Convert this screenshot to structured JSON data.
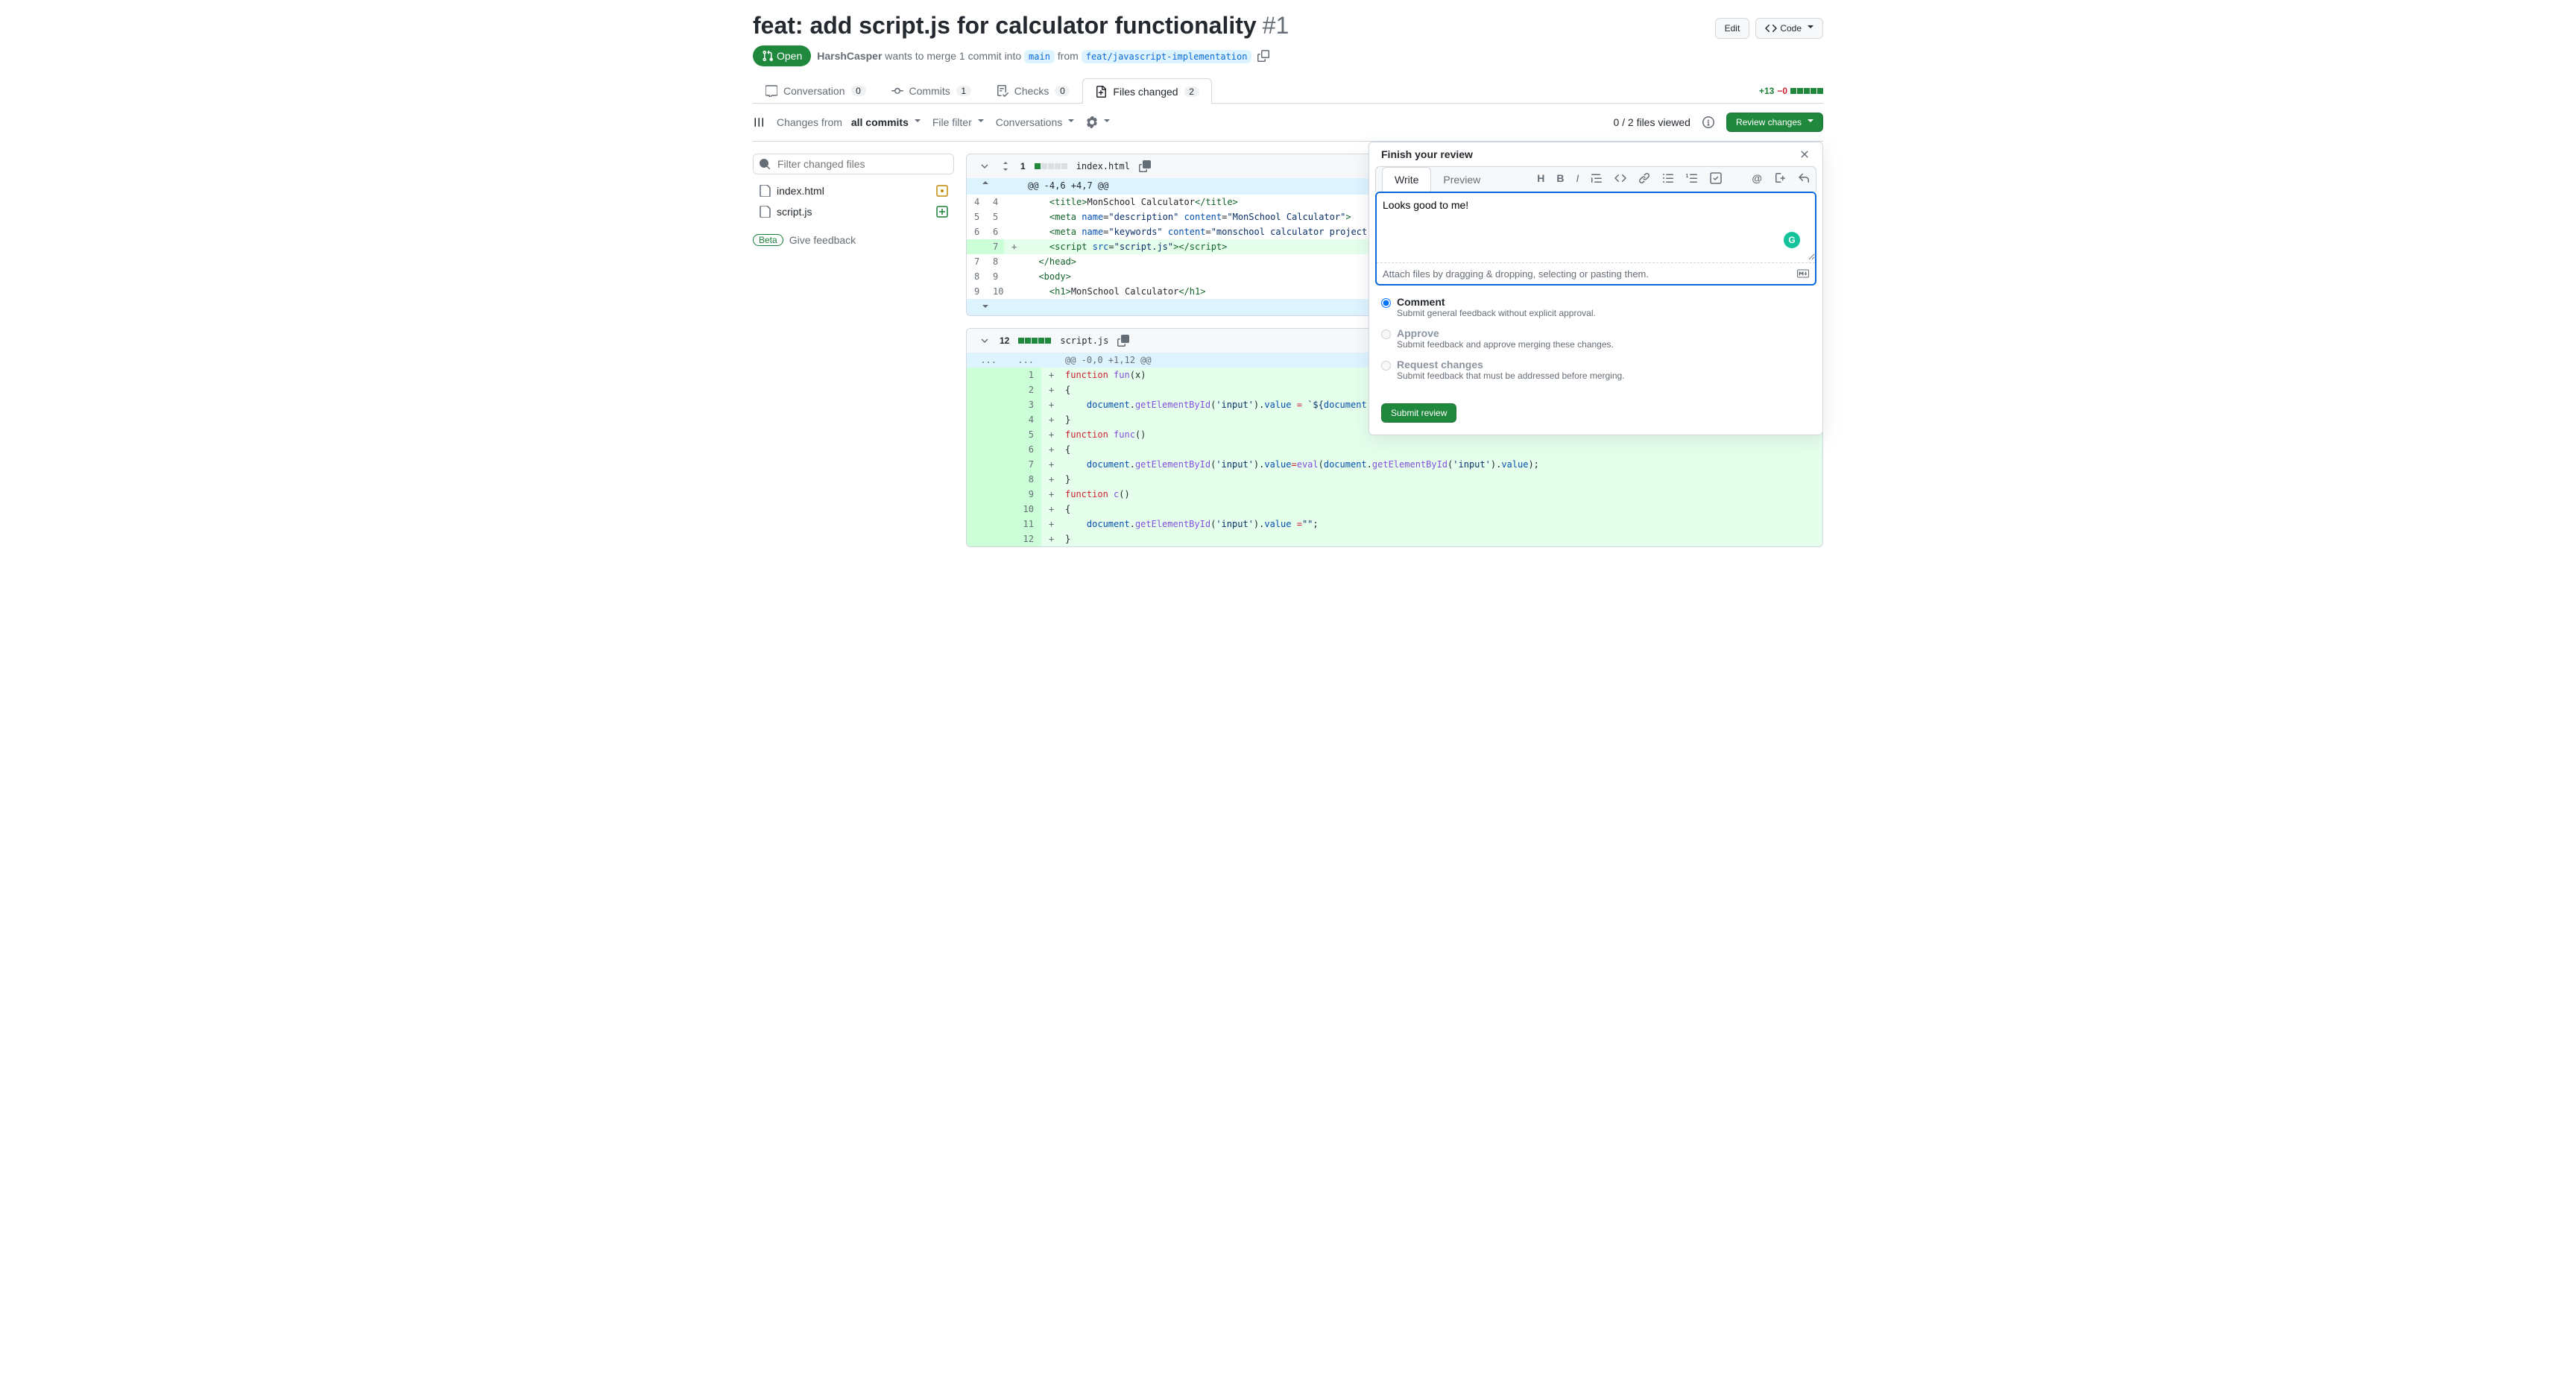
{
  "pr": {
    "title": "feat: add script.js for calculator functionality",
    "number": "#1",
    "state": "Open",
    "author": "HarshCasper",
    "merge_text_1": "wants to merge 1 commit into",
    "base_branch": "main",
    "merge_text_2": "from",
    "head_branch": "feat/javascript-implementation"
  },
  "header_actions": {
    "edit": "Edit",
    "code": "Code"
  },
  "tabs": {
    "conversation": {
      "label": "Conversation",
      "count": "0"
    },
    "commits": {
      "label": "Commits",
      "count": "1"
    },
    "checks": {
      "label": "Checks",
      "count": "0"
    },
    "files": {
      "label": "Files changed",
      "count": "2"
    }
  },
  "diffstat": {
    "additions": "+13",
    "deletions": "−0"
  },
  "toolbar": {
    "changes_from": "Changes from",
    "all_commits": "all commits",
    "file_filter": "File filter",
    "conversations": "Conversations",
    "files_viewed": "0 / 2 files viewed",
    "review_changes": "Review changes"
  },
  "sidebar": {
    "filter_placeholder": "Filter changed files",
    "files": [
      {
        "name": "index.html",
        "status": "modified"
      },
      {
        "name": "script.js",
        "status": "added"
      }
    ],
    "beta": "Beta",
    "feedback": "Give feedback"
  },
  "file1": {
    "name": "index.html",
    "changes": "1",
    "hunk": "@@ -4,6 +4,7 @@",
    "rows": [
      {
        "a": "4",
        "b": "4",
        "m": " ",
        "html": "    <span class='c-green'>&lt;title&gt;</span>MonSchool Calculator<span class='c-green'>&lt;/title&gt;</span>"
      },
      {
        "a": "5",
        "b": "5",
        "m": " ",
        "html": "    <span class='c-green'>&lt;meta</span> <span class='c-blue'>name</span>=<span class='c-navy'>\"description\"</span> <span class='c-blue'>content</span>=<span class='c-navy'>\"MonSchool Calculator\"</span><span class='c-green'>&gt;</span>"
      },
      {
        "a": "6",
        "b": "6",
        "m": " ",
        "html": "    <span class='c-green'>&lt;meta</span> <span class='c-blue'>name</span>=<span class='c-navy'>\"keywords\"</span> <span class='c-blue'>content</span>=<span class='c-navy'>\"monschool calculator project\"</span>"
      },
      {
        "a": "",
        "b": "7",
        "m": "+",
        "html": "    <span class='c-green'>&lt;script</span> <span class='c-blue'>src</span>=<span class='c-navy'>\"script.js\"</span><span class='c-green'>&gt;&lt;/script&gt;</span>",
        "add": true
      },
      {
        "a": "7",
        "b": "8",
        "m": " ",
        "html": "  <span class='c-green'>&lt;/head&gt;</span>"
      },
      {
        "a": "8",
        "b": "9",
        "m": " ",
        "html": "  <span class='c-green'>&lt;body&gt;</span>"
      },
      {
        "a": "9",
        "b": "10",
        "m": " ",
        "html": "    <span class='c-green'>&lt;h1&gt;</span>MonSchool Calculator<span class='c-green'>&lt;/h1&gt;</span>"
      }
    ]
  },
  "file2": {
    "name": "script.js",
    "changes": "12",
    "hunk": "@@ -0,0 +1,12 @@",
    "rows": [
      {
        "a": "",
        "b": "1",
        "m": "+",
        "html": "<span class='c-red'>function</span> <span class='c-purple'>fun</span>(<span>x</span>)",
        "add": true
      },
      {
        "a": "",
        "b": "2",
        "m": "+",
        "html": "{",
        "add": true
      },
      {
        "a": "",
        "b": "3",
        "m": "+",
        "html": "    <span class='c-blue'>document</span>.<span class='c-purple'>getElementById</span>(<span class='c-navy'>'input'</span>).<span class='c-blue'>value</span> <span class='c-red'>=</span> <span class='c-navy'>`${</span><span class='c-blue'>document</span>.<span class='c-purple'>getEl</span>",
        "add": true
      },
      {
        "a": "",
        "b": "4",
        "m": "+",
        "html": "}",
        "add": true
      },
      {
        "a": "",
        "b": "5",
        "m": "+",
        "html": "<span class='c-red'>function</span> <span class='c-purple'>func</span>()",
        "add": true
      },
      {
        "a": "",
        "b": "6",
        "m": "+",
        "html": "{",
        "add": true
      },
      {
        "a": "",
        "b": "7",
        "m": "+",
        "html": "    <span class='c-blue'>document</span>.<span class='c-purple'>getElementById</span>(<span class='c-navy'>'input'</span>).<span class='c-blue'>value</span><span class='c-red'>=</span><span class='c-purple'>eval</span>(<span class='c-blue'>document</span>.<span class='c-purple'>getElementById</span>(<span class='c-navy'>'input'</span>).<span class='c-blue'>value</span>);",
        "add": true
      },
      {
        "a": "",
        "b": "8",
        "m": "+",
        "html": "}",
        "add": true
      },
      {
        "a": "",
        "b": "9",
        "m": "+",
        "html": "<span class='c-red'>function</span> <span class='c-purple'>c</span>()",
        "add": true
      },
      {
        "a": "",
        "b": "10",
        "m": "+",
        "html": "{",
        "add": true
      },
      {
        "a": "",
        "b": "11",
        "m": "+",
        "html": "    <span class='c-blue'>document</span>.<span class='c-purple'>getElementById</span>(<span class='c-navy'>'input'</span>).<span class='c-blue'>value</span> <span class='c-red'>=</span><span class='c-navy'>\"\"</span>;",
        "add": true
      },
      {
        "a": "",
        "b": "12",
        "m": "+",
        "html": "}",
        "add": true
      }
    ]
  },
  "review": {
    "title": "Finish your review",
    "write_tab": "Write",
    "preview_tab": "Preview",
    "comment_text": "Looks good to me!",
    "attach_hint": "Attach files by dragging & dropping, selecting or pasting them.",
    "options": {
      "comment": {
        "label": "Comment",
        "desc": "Submit general feedback without explicit approval."
      },
      "approve": {
        "label": "Approve",
        "desc": "Submit feedback and approve merging these changes."
      },
      "request": {
        "label": "Request changes",
        "desc": "Submit feedback that must be addressed before merging."
      }
    },
    "submit": "Submit review"
  },
  "hunk_dots": "..."
}
